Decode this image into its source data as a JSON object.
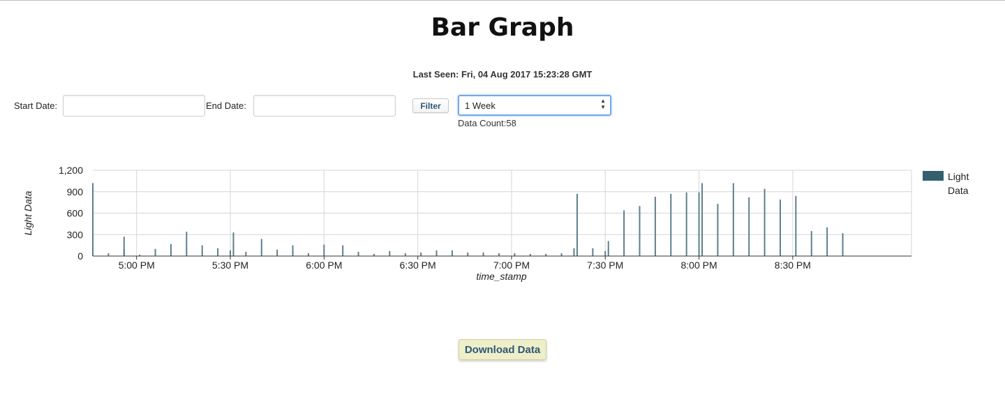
{
  "page": {
    "title": "Bar Graph",
    "last_seen": "Last Seen: Fri, 04 Aug 2017 15:23:28 GMT"
  },
  "filters": {
    "start_label": "Start Date:",
    "start_value": "",
    "end_label": "End Date:",
    "end_value": "",
    "filter_button": "Filter",
    "range_selected": "1 Week",
    "data_count": "Data Count:58"
  },
  "download_button": "Download Data",
  "colors": {
    "bar": "#5d7f8c",
    "bar_accent": "#335f6e",
    "grid": "#d6d6d6",
    "axis": "#333333"
  },
  "chart_data": {
    "type": "bar",
    "title": "",
    "xlabel": "time_stamp",
    "ylabel": "Light Data",
    "ylim": [
      0,
      1200
    ],
    "yticks": [
      "0",
      "300",
      "600",
      "900",
      "1,200"
    ],
    "ytick_values": [
      0,
      300,
      600,
      900,
      1200
    ],
    "xlim": [
      "16:46",
      "21:08"
    ],
    "xticks": [
      "5:00 PM",
      "5:30 PM",
      "6:00 PM",
      "6:30 PM",
      "7:00 PM",
      "7:30 PM",
      "8:00 PM",
      "8:30 PM"
    ],
    "xtick_values": [
      "17:00",
      "17:30",
      "18:00",
      "18:30",
      "19:00",
      "19:30",
      "20:00",
      "20:30"
    ],
    "grid": true,
    "legend_position": "right",
    "series": [
      {
        "name": "Light Data",
        "x": [
          "16:46",
          "16:51",
          "16:56",
          "16:56",
          "17:01",
          "17:06",
          "17:11",
          "17:16",
          "17:21",
          "17:26",
          "17:30",
          "17:31",
          "17:31",
          "17:35",
          "17:40",
          "17:45",
          "17:50",
          "17:55",
          "18:00",
          "18:06",
          "18:11",
          "18:16",
          "18:21",
          "18:26",
          "18:31",
          "18:36",
          "18:41",
          "18:46",
          "18:51",
          "18:56",
          "19:01",
          "19:06",
          "19:11",
          "19:16",
          "19:20",
          "19:21",
          "19:26",
          "19:30",
          "19:31",
          "19:36",
          "19:41",
          "19:46",
          "19:51",
          "19:56",
          "20:00",
          "20:01",
          "20:06",
          "20:11",
          "20:16",
          "20:21",
          "20:26",
          "20:31",
          "20:36",
          "20:41",
          "20:46",
          "20:51",
          "20:56",
          "21:01"
        ],
        "values": [
          1020,
          40,
          270,
          90,
          20,
          100,
          170,
          340,
          150,
          110,
          80,
          330,
          180,
          60,
          240,
          90,
          150,
          40,
          160,
          150,
          60,
          30,
          70,
          40,
          50,
          80,
          80,
          50,
          50,
          40,
          40,
          30,
          30,
          40,
          110,
          870,
          110,
          70,
          210,
          640,
          700,
          830,
          870,
          890,
          890,
          1020,
          730,
          1020,
          820,
          940,
          790,
          840,
          350,
          400,
          320,
          0,
          0,
          0
        ]
      }
    ]
  }
}
